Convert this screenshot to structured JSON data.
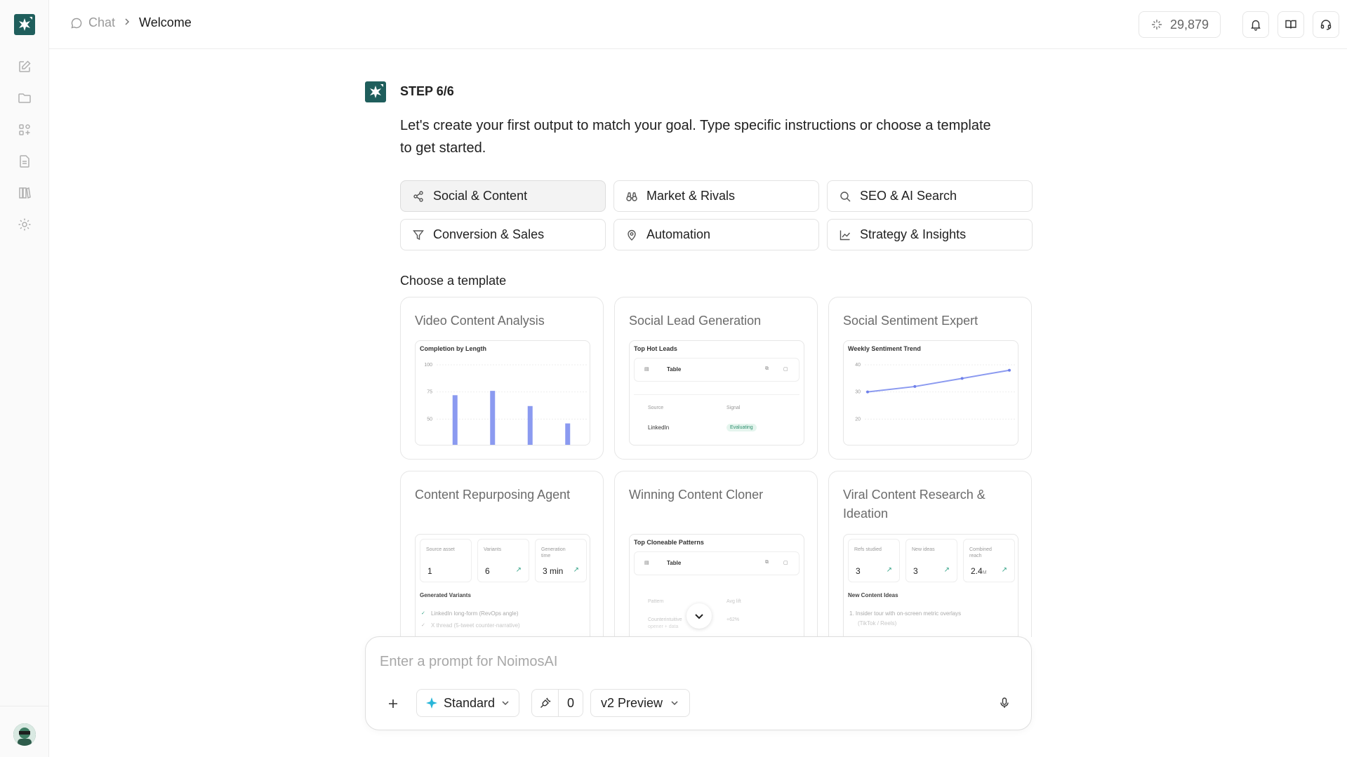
{
  "breadcrumb": {
    "chat": "Chat",
    "current": "Welcome"
  },
  "credits": "29,879",
  "step": {
    "label": "STEP 6/6",
    "text": "Let's create your first output to match your goal. Type specific instructions or choose a template to get started."
  },
  "categories": [
    {
      "label": "Social & Content",
      "icon": "share-icon",
      "active": true
    },
    {
      "label": "Market & Rivals",
      "icon": "binoculars-icon",
      "active": false
    },
    {
      "label": "SEO & AI Search",
      "icon": "search-icon",
      "active": false
    },
    {
      "label": "Conversion & Sales",
      "icon": "filter-icon",
      "active": false
    },
    {
      "label": "Automation",
      "icon": "map-pin-icon",
      "active": false
    },
    {
      "label": "Strategy & Insights",
      "icon": "line-chart-icon",
      "active": false
    }
  ],
  "choose_label": "Choose a template",
  "templates": [
    {
      "title": "Video Content Analysis",
      "preview": {
        "title": "Completion by Length",
        "chart_data": {
          "type": "bar",
          "yticks": [
            "100",
            "75",
            "50"
          ],
          "values": [
            72,
            76,
            62,
            46
          ],
          "ylim": [
            25,
            100
          ]
        }
      }
    },
    {
      "title": "Social Lead Generation",
      "preview": {
        "title": "Top Hot Leads",
        "table_label": "Table",
        "col1": "Source",
        "col2": "Signal",
        "row_source": "LinkedIn",
        "row_signal": "Evaluating"
      }
    },
    {
      "title": "Social Sentiment Expert",
      "preview": {
        "title": "Weekly Sentiment Trend",
        "chart_data": {
          "type": "line",
          "yticks": [
            "40",
            "30",
            "20"
          ],
          "values": [
            30,
            32,
            35,
            38
          ],
          "ylim": [
            10,
            40
          ]
        }
      }
    },
    {
      "title": "Content Repurposing Agent",
      "preview": {
        "stats": [
          {
            "label": "Source asset",
            "value": "1"
          },
          {
            "label": "Variants",
            "value": "6"
          },
          {
            "label": "Generation time",
            "value": "3 min"
          }
        ],
        "section": "Generated Variants",
        "items": [
          "LinkedIn long-form (RevOps angle)",
          "X thread (5-tweet counter-narrative)"
        ]
      }
    },
    {
      "title": "Winning Content Cloner",
      "preview": {
        "title": "Top Cloneable Patterns",
        "table_label": "Table",
        "col1": "Pattern",
        "col2": "Avg lift",
        "row_a": "Counterintuitive",
        "row_a2": "opener + data",
        "row_b": "+62%"
      }
    },
    {
      "title": "Viral Content Research & Ideation",
      "preview": {
        "stats": [
          {
            "label": "Refs studied",
            "value": "3"
          },
          {
            "label": "New ideas",
            "value": "3"
          },
          {
            "label": "Combined reach",
            "value": "2.4",
            "suffix": "M"
          }
        ],
        "section": "New Content Ideas",
        "items": [
          "1. Insider tour with on-screen metric overlays",
          "(TikTok / Reels)"
        ]
      }
    }
  ],
  "composer": {
    "placeholder": "Enter a prompt for NoimosAI",
    "mode": "Standard",
    "tool_count": "0",
    "version": "v2 Preview"
  }
}
